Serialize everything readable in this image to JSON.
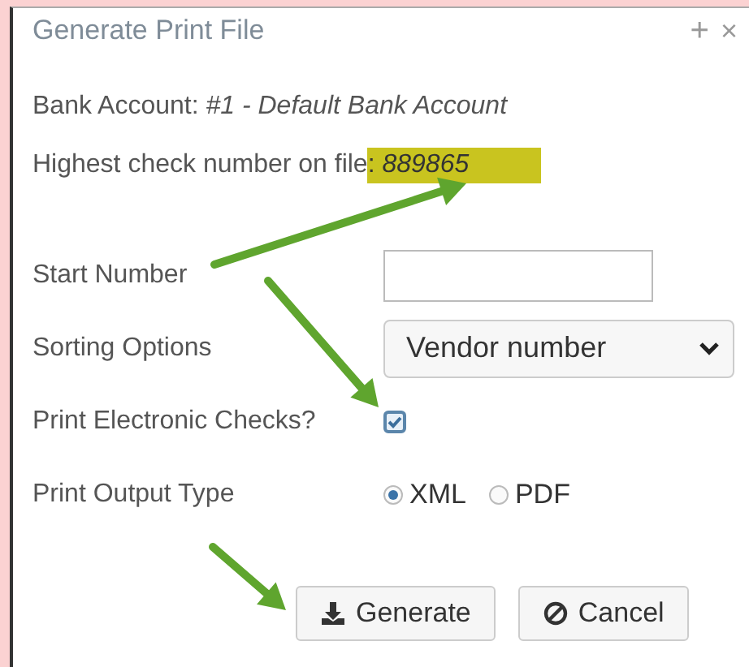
{
  "dialog": {
    "title": "Generate Print File",
    "title_buttons": [
      {
        "kind": "plus",
        "label": "+"
      },
      {
        "kind": "close",
        "label": "×"
      }
    ],
    "bank_account": "Bank Account: *#1 - Default Bank Account*",
    "highest_check": {
      "label": "Highest check number on file",
      "value": ": *889865*",
      "highlighted": true
    },
    "fields": [
      {
        "kind": "text",
        "label": "Start Number"
      },
      {
        "kind": "select",
        "label": "Sorting Options",
        "value": "Vendor number"
      },
      {
        "kind": "checkbox",
        "label": "Print Electronic Checks?",
        "checked": true
      },
      {
        "kind": "radio",
        "label": "Print Output Type",
        "options": [
          {
            "label": "XML",
            "selected": true
          },
          {
            "label": "PDF",
            "selected": false
          }
        ]
      }
    ],
    "buttons": [
      {
        "kind": "download",
        "label": "Generate"
      },
      {
        "kind": "cancel",
        "label": "Cancel"
      }
    ]
  }
}
